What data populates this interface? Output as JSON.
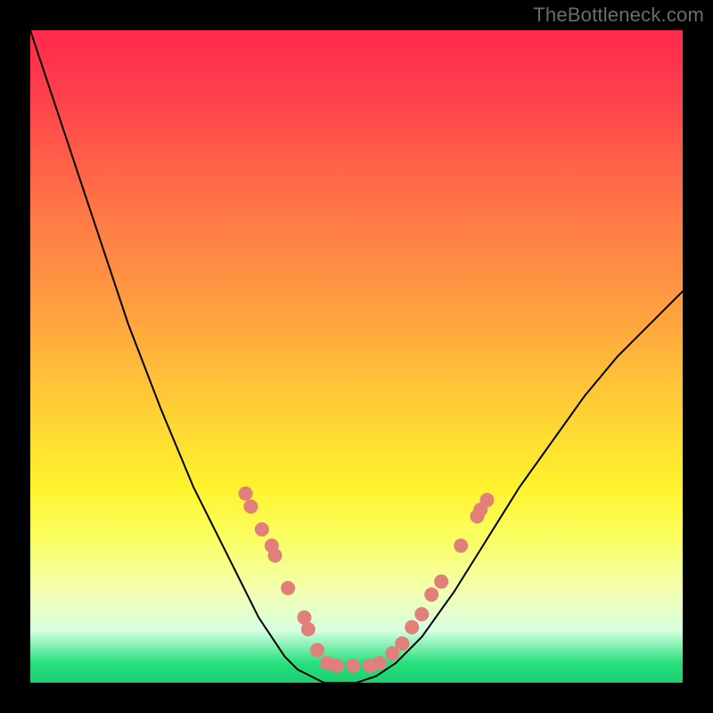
{
  "watermark": "TheBottleneck.com",
  "chart_data": {
    "type": "line",
    "title": "",
    "xlabel": "",
    "ylabel": "",
    "xlim": [
      0,
      100
    ],
    "ylim": [
      0,
      100
    ],
    "grid": false,
    "legend": false,
    "annotations": [],
    "series": [
      {
        "name": "left-curve",
        "stroke": "#000000",
        "x": [
          0,
          5,
          10,
          15,
          20,
          25,
          28,
          30,
          33,
          35,
          37,
          39,
          41,
          43,
          45
        ],
        "y": [
          100,
          85,
          70,
          55,
          42,
          30,
          24,
          20,
          14,
          10,
          7,
          4,
          2,
          1,
          0
        ]
      },
      {
        "name": "right-curve",
        "stroke": "#000000",
        "x": [
          50,
          53,
          56,
          60,
          65,
          70,
          75,
          80,
          85,
          90,
          95,
          100
        ],
        "y": [
          0,
          1,
          3,
          7,
          14,
          22,
          30,
          37,
          44,
          50,
          55,
          60
        ]
      },
      {
        "name": "floor-segment",
        "stroke": "#000000",
        "x": [
          45,
          47,
          50
        ],
        "y": [
          0,
          0,
          0
        ]
      }
    ],
    "markers": {
      "name": "accent-dots",
      "fill": "#e1807a",
      "points": [
        {
          "x": 33.0,
          "y": 29.0
        },
        {
          "x": 33.8,
          "y": 27.0
        },
        {
          "x": 35.5,
          "y": 23.5
        },
        {
          "x": 37.0,
          "y": 21.0
        },
        {
          "x": 37.5,
          "y": 19.5
        },
        {
          "x": 39.5,
          "y": 14.5
        },
        {
          "x": 42.0,
          "y": 10.0
        },
        {
          "x": 42.6,
          "y": 8.2
        },
        {
          "x": 44.0,
          "y": 5.0
        },
        {
          "x": 45.5,
          "y": 3.0
        },
        {
          "x": 47.0,
          "y": 2.6
        },
        {
          "x": 49.5,
          "y": 2.6
        },
        {
          "x": 52.0,
          "y": 2.6
        },
        {
          "x": 53.5,
          "y": 3.0
        },
        {
          "x": 55.5,
          "y": 4.5
        },
        {
          "x": 57.0,
          "y": 6.0
        },
        {
          "x": 58.5,
          "y": 8.5
        },
        {
          "x": 60.0,
          "y": 10.5
        },
        {
          "x": 61.5,
          "y": 13.5
        },
        {
          "x": 63.0,
          "y": 15.5
        },
        {
          "x": 66.0,
          "y": 21.0
        },
        {
          "x": 68.5,
          "y": 25.5
        },
        {
          "x": 69.0,
          "y": 26.5
        },
        {
          "x": 70.0,
          "y": 28.0
        }
      ]
    }
  }
}
